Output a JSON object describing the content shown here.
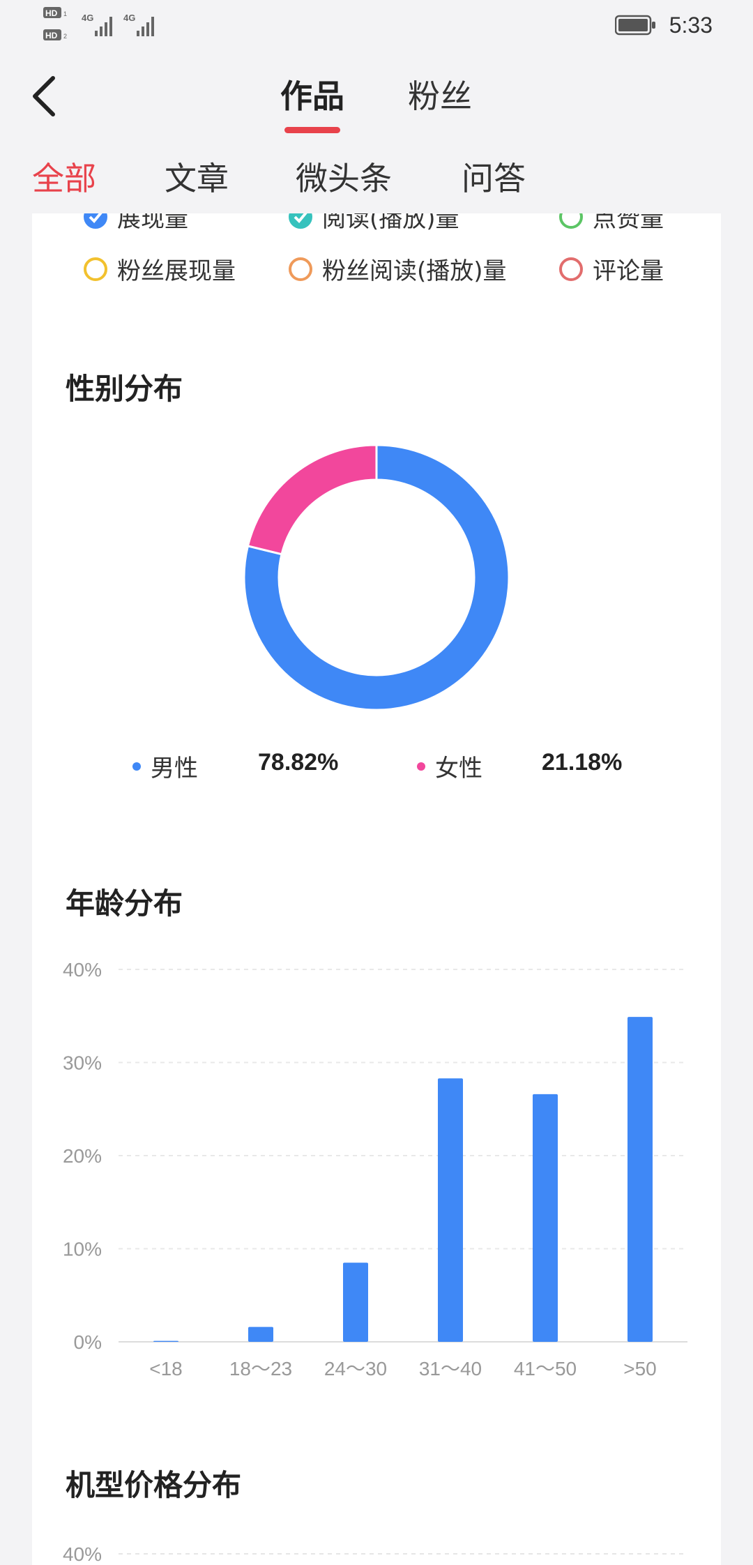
{
  "status_bar": {
    "left_labels": [
      "HD",
      "4G",
      "HD",
      "4G"
    ],
    "time": "5:33"
  },
  "header": {
    "tabs": [
      {
        "label": "作品",
        "active": true
      },
      {
        "label": "粉丝",
        "active": false
      }
    ],
    "accent_color": "#e8424b"
  },
  "sub_tabs": [
    {
      "label": "全部",
      "active": true
    },
    {
      "label": "文章",
      "active": false
    },
    {
      "label": "微头条",
      "active": false
    },
    {
      "label": "问答",
      "active": false
    }
  ],
  "metric_legend": [
    {
      "label": "展现量",
      "checked": true,
      "color": "#3f88f6"
    },
    {
      "label": "阅读(播放)量",
      "checked": true,
      "color": "#36c2bd"
    },
    {
      "label": "点赞量",
      "checked": false,
      "color": "#5cc565"
    },
    {
      "label": "粉丝展现量",
      "checked": false,
      "color": "#f2c12e"
    },
    {
      "label": "粉丝阅读(播放)量",
      "checked": false,
      "color": "#ef9a5a"
    },
    {
      "label": "评论量",
      "checked": false,
      "color": "#e26d6d"
    }
  ],
  "gender_section": {
    "title": "性别分布",
    "chart_data": {
      "type": "pie",
      "slices": [
        {
          "label": "男性",
          "value": 78.82,
          "display": "78.82%",
          "color": "#3f88f6"
        },
        {
          "label": "女性",
          "value": 21.18,
          "display": "21.18%",
          "color": "#f2479c"
        }
      ]
    }
  },
  "age_section": {
    "title": "年龄分布",
    "chart_data": {
      "type": "bar",
      "categories": [
        "<18",
        "18～23",
        "24～30",
        "31～40",
        "41～50",
        ">50"
      ],
      "values": [
        0.1,
        1.6,
        8.5,
        28.3,
        26.6,
        34.9
      ],
      "ylim": [
        0,
        40
      ],
      "yticks": [
        "0%",
        "10%",
        "20%",
        "30%",
        "40%"
      ],
      "bar_color": "#3f88f6",
      "grid": true
    }
  },
  "price_section": {
    "title": "机型价格分布",
    "top_tick": "40%"
  }
}
